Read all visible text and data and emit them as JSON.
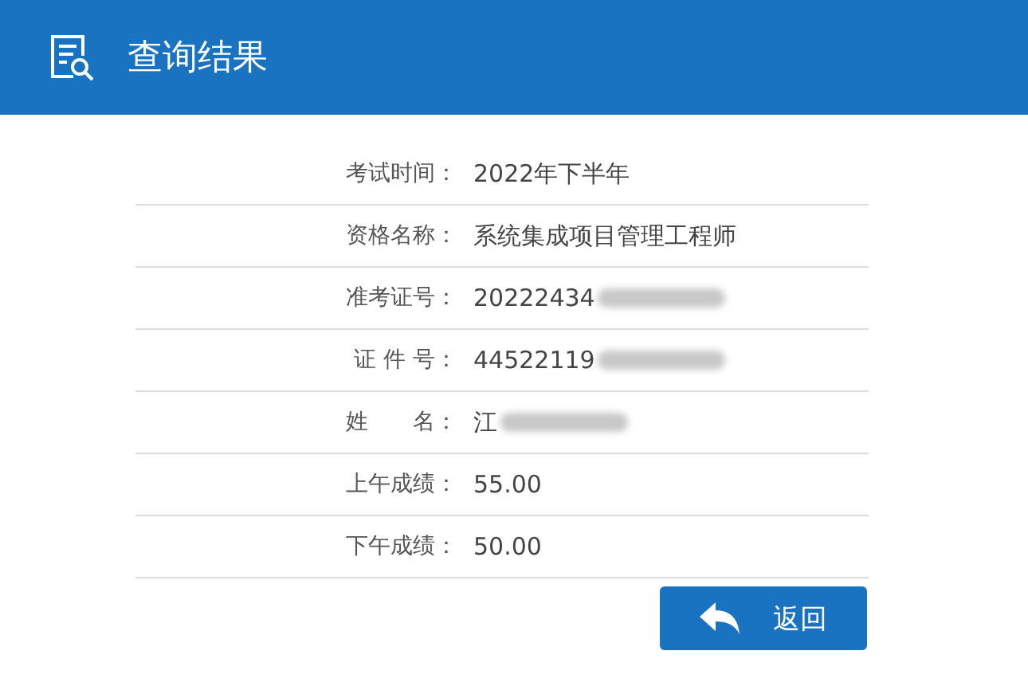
{
  "header": {
    "title": "查询结果"
  },
  "rows": [
    {
      "label": "考试时间：",
      "value": "2022年下半年",
      "redacted": false
    },
    {
      "label": "资格名称：",
      "value": "系统集成项目管理工程师",
      "redacted": false
    },
    {
      "label": "准考证号：",
      "value": "20222434",
      "redacted": true
    },
    {
      "label": "证 件 号：",
      "value": "44522119",
      "redacted": true
    },
    {
      "label": "姓　　名：",
      "value": "江",
      "redacted": true
    },
    {
      "label": "上午成绩：",
      "value": "55.00",
      "redacted": false
    },
    {
      "label": "下午成绩：",
      "value": "50.00",
      "redacted": false
    }
  ],
  "back_button": {
    "label": "返回"
  }
}
